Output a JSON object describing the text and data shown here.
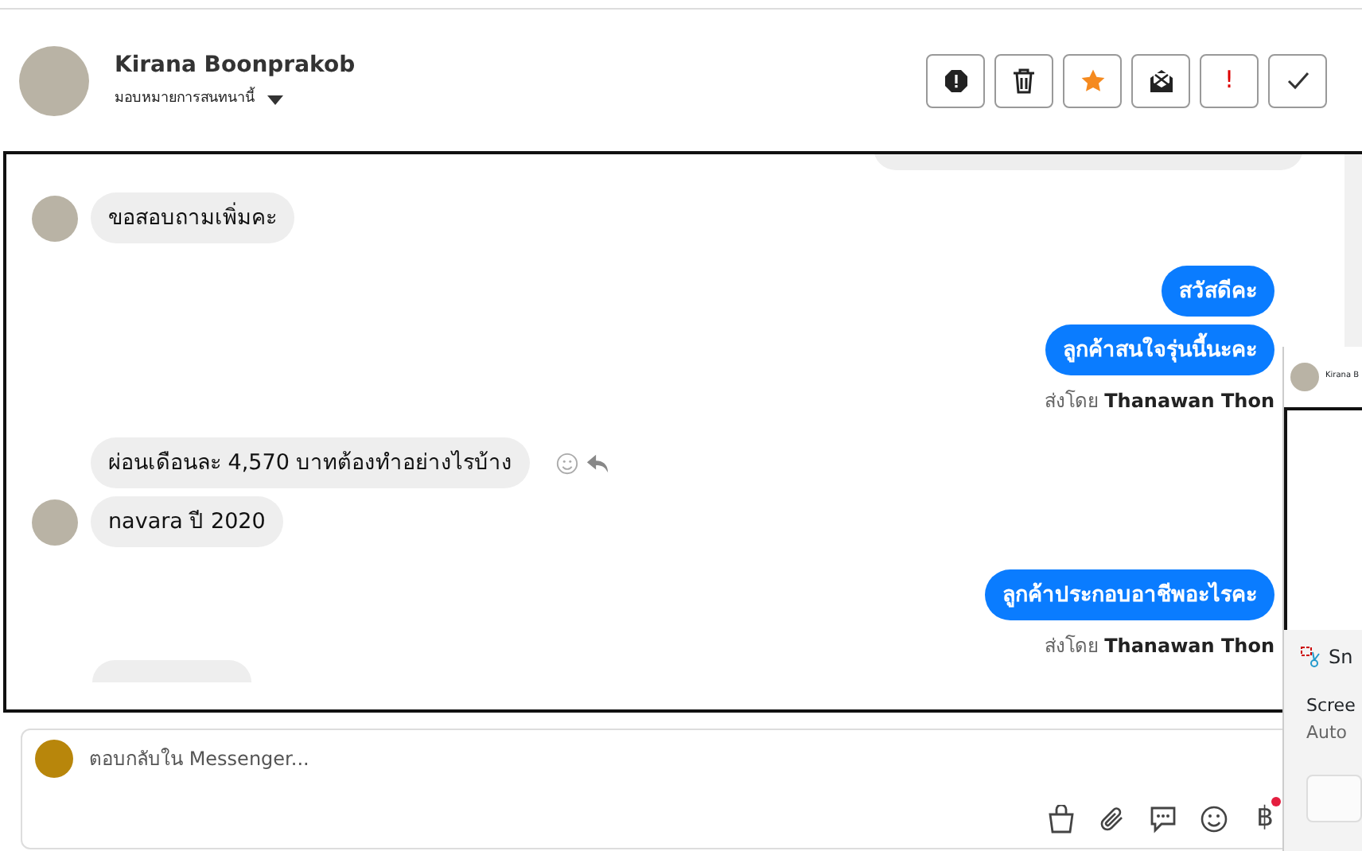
{
  "header": {
    "name": "Kirana Boonprakob",
    "assign_label": "มอบหมายการสนทนานี้",
    "actions": [
      {
        "kind": "spam"
      },
      {
        "kind": "trash"
      },
      {
        "kind": "star"
      },
      {
        "kind": "mail"
      },
      {
        "kind": "important",
        "glyph": "!"
      },
      {
        "kind": "done"
      }
    ]
  },
  "messages": [
    {
      "kind": "clipped_outgoing"
    },
    {
      "kind": "incoming",
      "text": "ขอสอบถามเพิ่มคะ",
      "avatar": true
    },
    {
      "kind": "outgoing",
      "text": "สวัสดีคะ"
    },
    {
      "kind": "outgoing",
      "text": "ลูกค้าสนใจรุ่นนี้นะคะ",
      "sender_prefix": "ส่งโดย",
      "sender": "Thanawan Thon"
    },
    {
      "kind": "incoming",
      "text": "ผ่อนเดือนละ 4,570 บาทต้องทำอย่างไรบ้าง",
      "avatar": false,
      "hover_actions": true
    },
    {
      "kind": "incoming",
      "text": "navara ปี 2020",
      "avatar": true
    },
    {
      "kind": "outgoing",
      "text": "ลูกค้าประกอบอาชีพอะไรคะ",
      "sender_prefix": "ส่งโดย",
      "sender": "Thanawan Thon"
    },
    {
      "kind": "clipped_incoming"
    }
  ],
  "reply": {
    "placeholder": "ตอบกลับใน Messenger...",
    "tools": [
      {
        "kind": "bag"
      },
      {
        "kind": "clip"
      },
      {
        "kind": "chat"
      },
      {
        "kind": "emoji"
      },
      {
        "kind": "baht",
        "glyph": "฿",
        "badge": true
      }
    ]
  },
  "notification": {
    "name": "Kirana B",
    "app": "Sn",
    "title": "Scree",
    "body": "Auto"
  }
}
